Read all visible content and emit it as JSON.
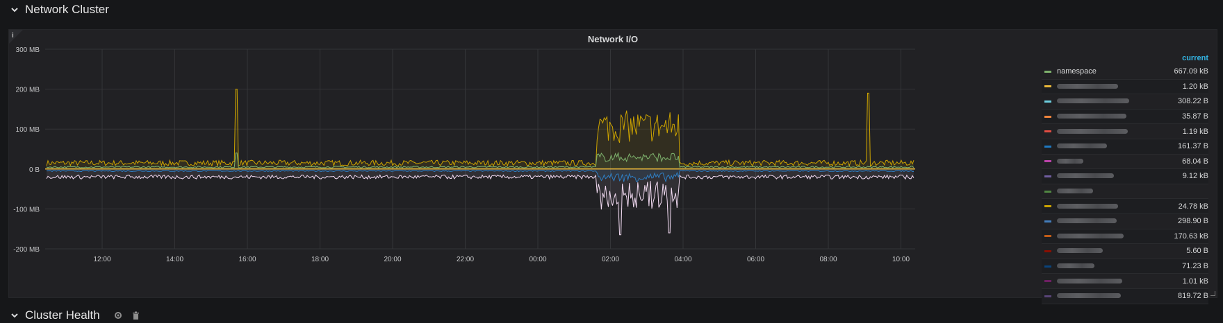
{
  "rows": [
    {
      "title": "Network Cluster"
    },
    {
      "title": "Cluster Health"
    }
  ],
  "icons": {
    "collapse": "chevron-down-icon",
    "settings": "gear-icon",
    "delete": "trash-icon",
    "info": "info-icon"
  },
  "panel": {
    "title": "Network I/O",
    "info_glyph": "i"
  },
  "legend": {
    "header": "current",
    "items": [
      {
        "name": "namespace",
        "color": "#7eb26d",
        "value": "667.09 kB"
      },
      {
        "name": "",
        "color": "#eab839",
        "value": "1.20 kB"
      },
      {
        "name": "",
        "color": "#6ed0e0",
        "value": "308.22 B"
      },
      {
        "name": "",
        "color": "#ef843c",
        "value": "35.87 B"
      },
      {
        "name": "",
        "color": "#e24d42",
        "value": "1.19 kB"
      },
      {
        "name": "",
        "color": "#1f78c1",
        "value": "161.37 B"
      },
      {
        "name": "",
        "color": "#ba43a9",
        "value": "68.04 B"
      },
      {
        "name": "",
        "color": "#705da0",
        "value": "9.12 kB"
      },
      {
        "name": "",
        "color": "#508642",
        "value": ""
      },
      {
        "name": "",
        "color": "#cca300",
        "value": "24.78 kB"
      },
      {
        "name": "",
        "color": "#447ebc",
        "value": "298.90 B"
      },
      {
        "name": "",
        "color": "#c15c17",
        "value": "170.63 kB"
      },
      {
        "name": "",
        "color": "#890f02",
        "value": "5.60 B"
      },
      {
        "name": "",
        "color": "#0a437c",
        "value": "71.23 B"
      },
      {
        "name": "",
        "color": "#6d1f62",
        "value": "1.01 kB"
      },
      {
        "name": "",
        "color": "#584477",
        "value": "819.72 B"
      }
    ]
  },
  "chart_data": {
    "type": "area",
    "title": "Network I/O",
    "x_ticks": [
      "12:00",
      "14:00",
      "16:00",
      "18:00",
      "20:00",
      "22:00",
      "00:00",
      "02:00",
      "04:00",
      "06:00",
      "08:00",
      "10:00"
    ],
    "y_ticks": [
      "300 MB",
      "200 MB",
      "100 MB",
      "0 B",
      "-100 MB",
      "-200 MB"
    ],
    "y_tick_values": [
      300,
      200,
      100,
      0,
      -100,
      -200
    ],
    "ylim": [
      -200,
      300
    ],
    "grid": true,
    "legend_position": "right",
    "series": [
      {
        "name": "namespace",
        "color": "#7eb26d",
        "baseline_mb": 5,
        "burst_mb": 25
      },
      {
        "color": "#cca300",
        "baseline_mb": 15,
        "burst_mb": 90
      },
      {
        "color": "#eab839",
        "baseline_mb": 0,
        "burst_mb": 0
      },
      {
        "color": "#f0d9f0",
        "baseline_mb": -20,
        "burst_mb": -80
      },
      {
        "color": "#1f78c1",
        "baseline_mb": -5,
        "burst_mb": -25
      }
    ]
  }
}
